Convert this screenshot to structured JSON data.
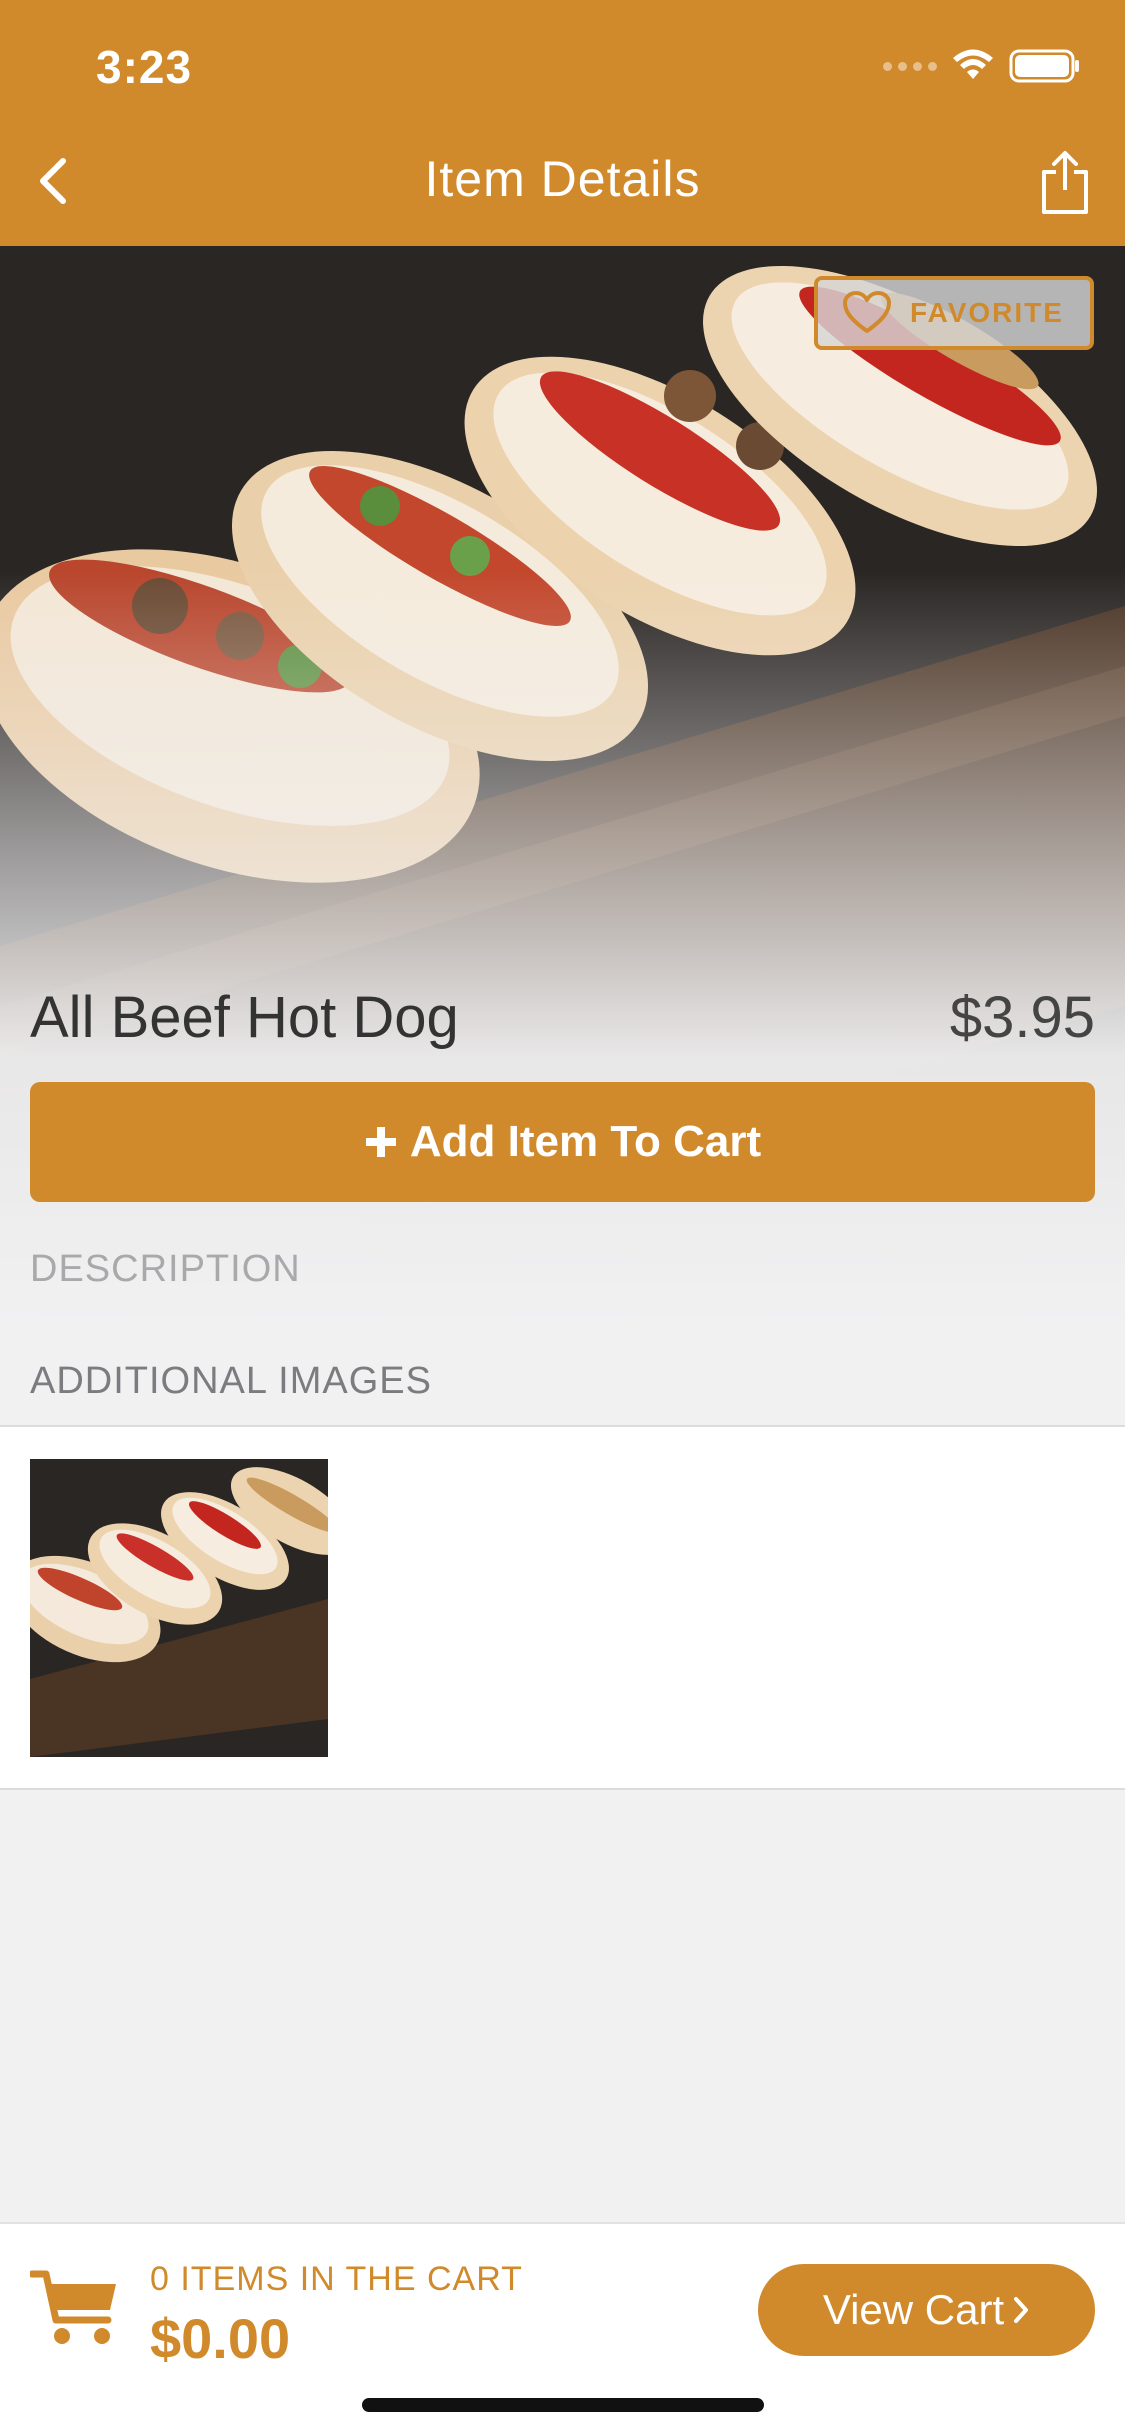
{
  "status_bar": {
    "time": "3:23"
  },
  "nav": {
    "title": "Item Details"
  },
  "item": {
    "name": "All Beef Hot Dog",
    "price": "$3.95",
    "favorite_label": "FAVORITE",
    "add_to_cart_label": "Add Item To Cart"
  },
  "sections": {
    "description_label": "DESCRIPTION",
    "additional_images_label": "ADDITIONAL IMAGES"
  },
  "cart": {
    "count_label": "0 ITEMS IN THE CART",
    "total": "$0.00",
    "view_cart_label": "View Cart"
  },
  "colors": {
    "accent": "#d18a2b",
    "background": "#f1f1f2",
    "text_dark": "#333333",
    "muted": "#a9a9ac"
  },
  "icons": [
    "back-chevron-icon",
    "share-icon",
    "heart-icon",
    "plus-icon",
    "cart-icon",
    "chevron-right-icon",
    "wifi-icon",
    "battery-icon"
  ]
}
